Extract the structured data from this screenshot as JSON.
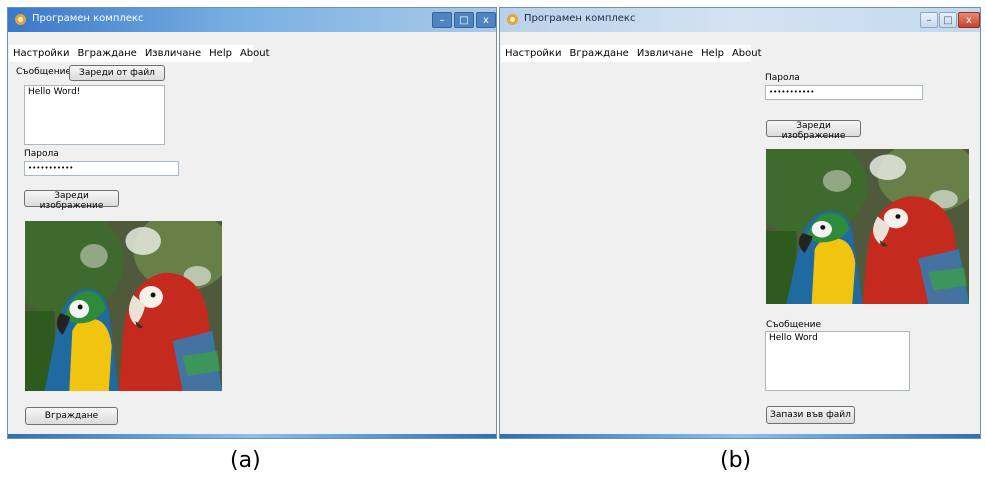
{
  "window_a": {
    "title": "Програмен комплекс",
    "controls": {
      "minimize": "–",
      "maximize": "□",
      "close": "x"
    },
    "menu": [
      "Настройки",
      "Вграждане",
      "Извличане",
      "Help",
      "About"
    ],
    "message_label": "Съобщение",
    "load_file_button": "Зареди от файл",
    "message_value": "Hello Word!",
    "password_label": "Парола",
    "password_value": "•••••••••••",
    "load_image_button": "Зареди изображение",
    "image_icon": "parrots-image",
    "embed_button": "Вграждане"
  },
  "window_b": {
    "title": "Програмен комплекс",
    "controls": {
      "minimize": "–",
      "maximize": "□",
      "close": "x"
    },
    "menu": [
      "Настройки",
      "Вграждане",
      "Извличане",
      "Help",
      "About"
    ],
    "password_label": "Парола",
    "password_value": "•••••••••••",
    "load_image_button": "Зареди изображение",
    "image_icon": "parrots-image",
    "message_label": "Съобщение",
    "message_value": "Hello Word",
    "save_file_button": "Запази във файл"
  },
  "captions": {
    "a": "(a)",
    "b": "(b)"
  },
  "colors": {
    "title_active": "#3a78c9",
    "window_bg": "#f0f0f0",
    "close_red": "#c7452c"
  }
}
